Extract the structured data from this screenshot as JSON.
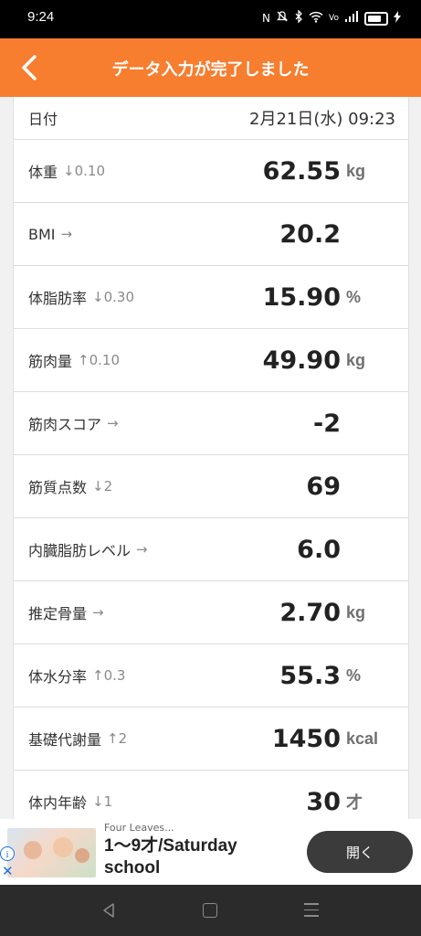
{
  "status": {
    "time": "9:24",
    "icons": [
      "nfc-icon",
      "mute-icon",
      "bluetooth-icon",
      "wifi-icon",
      "volte-icon",
      "signal-icon",
      "battery-icon",
      "charging-icon"
    ]
  },
  "header": {
    "title": "データ入力が完了しました",
    "back_icon": "chevron-left-icon",
    "background": "#f77d2f"
  },
  "date_row": {
    "label": "日付",
    "value": "2月21日(水) 09:23"
  },
  "metrics": [
    {
      "label": "体重",
      "trend": "↓0.10",
      "value": "62.55",
      "unit": "kg"
    },
    {
      "label": "BMI",
      "trend": "→",
      "value": "20.2",
      "unit": ""
    },
    {
      "label": "体脂肪率",
      "trend": "↓0.30",
      "value": "15.90",
      "unit": "%"
    },
    {
      "label": "筋肉量",
      "trend": "↑0.10",
      "value": "49.90",
      "unit": "kg"
    },
    {
      "label": "筋肉スコア",
      "trend": "→",
      "value": "-2",
      "unit": ""
    },
    {
      "label": "筋質点数",
      "trend": "↓2",
      "value": "69",
      "unit": ""
    },
    {
      "label": "内臓脂肪レベル",
      "trend": "→",
      "value": "6.0",
      "unit": ""
    },
    {
      "label": "推定骨量",
      "trend": "→",
      "value": "2.70",
      "unit": "kg"
    },
    {
      "label": "体水分率",
      "trend": "↑0.3",
      "value": "55.3",
      "unit": "%"
    },
    {
      "label": "基礎代謝量",
      "trend": "↑2",
      "value": "1450",
      "unit": "kcal"
    },
    {
      "label": "体内年齢",
      "trend": "↓1",
      "value": "30",
      "unit": "才"
    }
  ],
  "ad": {
    "sponsor": "Four Leaves...",
    "title": "1〜9才/Saturday school",
    "button": "開く"
  },
  "navbar": {
    "icons": [
      "back-triangle-icon",
      "home-square-icon",
      "menu-lines-icon"
    ]
  }
}
